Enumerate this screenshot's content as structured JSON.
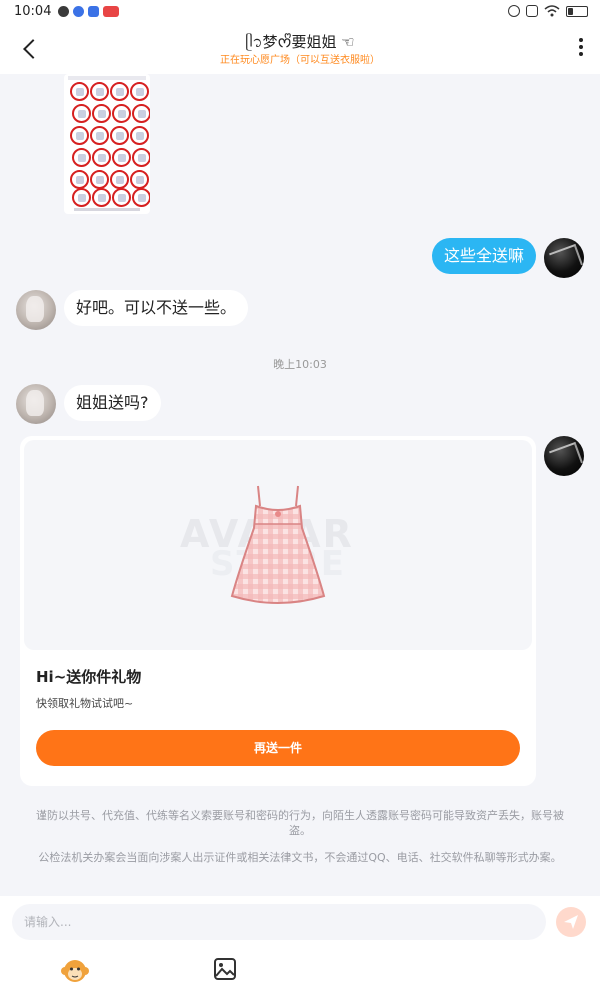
{
  "status_bar": {
    "time": "10:04",
    "notification_colors": [
      "#3a3a3a",
      "#3b72e6",
      "#3b72e6",
      "#e84545"
    ],
    "battery_level": 0.3
  },
  "header": {
    "title": "ᥫ᭡梦ᰔᩚ要姐姐 ☜",
    "subtitle": "正在玩心愿广场（可以互送衣服啦）",
    "accent_color": "#ff8a1f"
  },
  "messages": [
    {
      "from": "me",
      "text": "这些全送嘛"
    },
    {
      "from": "other",
      "text": "好吧。可以不送一些。"
    },
    {
      "from": "other",
      "text": "姐姐送吗?"
    }
  ],
  "time_divider": "晚上10:03",
  "gift_card": {
    "title": "Hi~送你件礼物",
    "description": "快领取礼物试试吧~",
    "button_label": "再送一件",
    "watermark": "AVATAR",
    "watermark2": "STORE",
    "button_color": "#ff7417"
  },
  "notices": [
    "谨防以共号、代充值、代练等名义索要账号和密码的行为，向陌生人透露账号密码可能导致资产丢失，账号被盗。",
    "公检法机关办案会当面向涉案人出示证件或相关法律文书，不会通过QQ、电话、社交软件私聊等形式办案。"
  ],
  "input": {
    "placeholder": "请输入..."
  },
  "icons": {
    "back": "chevron-left-icon",
    "more": "vertical-dots-icon",
    "send": "paper-plane-icon",
    "emoji": "monkey-face-icon",
    "image": "image-icon"
  },
  "colors": {
    "outgoing_bubble": "#2bb6f3",
    "incoming_bubble": "#ffffff",
    "background": "#f4f5f9"
  }
}
